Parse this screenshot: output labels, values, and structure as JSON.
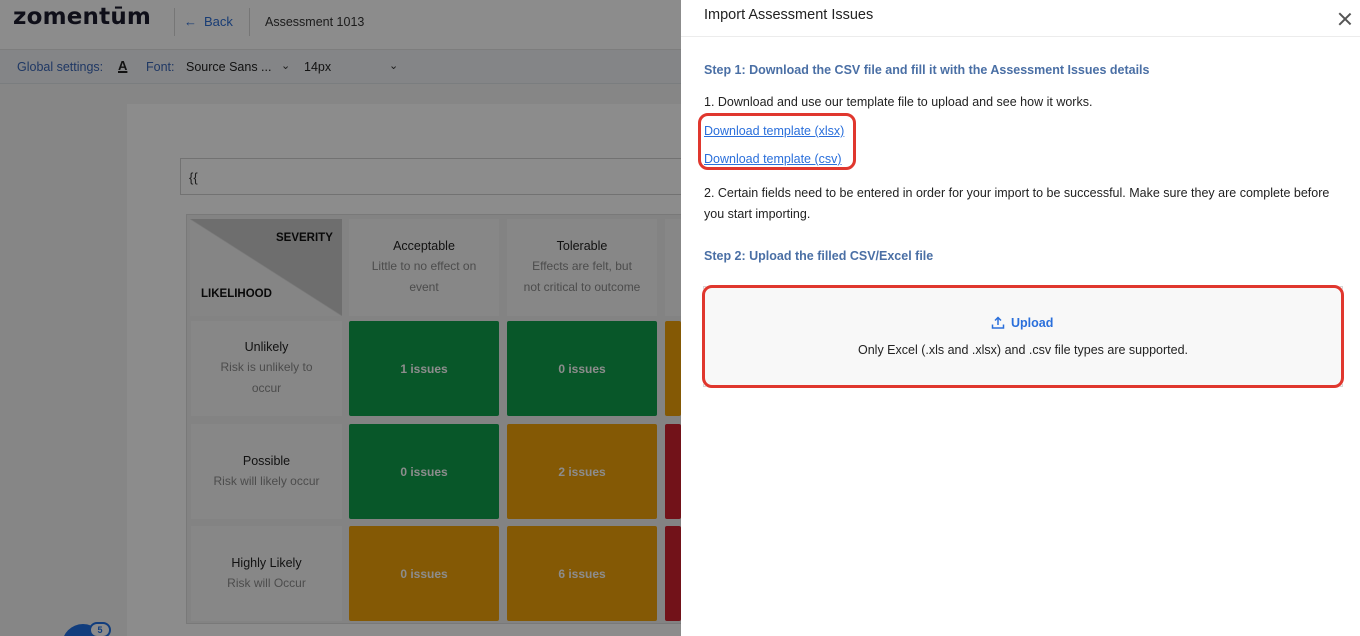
{
  "app": {
    "logo": "zomentūm",
    "back_label": "Back",
    "assessment_title": "Assessment 1013"
  },
  "settings": {
    "global_label": "Global settings:",
    "font_color_glyph": "A",
    "font_label": "Font:",
    "font_value": "Source Sans ...",
    "size_value": "14px"
  },
  "editor": {
    "input_value": "{{"
  },
  "matrix": {
    "severity_label": "SEVERITY",
    "likelihood_label": "LIKELIHOOD",
    "columns": [
      {
        "title": "Acceptable",
        "subtitle": "Little to no effect on event"
      },
      {
        "title": "Tolerable",
        "subtitle": "Effects are felt, but not critical to outcome"
      }
    ],
    "rows": [
      {
        "title": "Unlikely",
        "subtitle": "Risk is unlikely to occur",
        "cells": [
          "1 issues",
          "0 issues"
        ]
      },
      {
        "title": "Possible",
        "subtitle": "Risk will likely occur",
        "cells": [
          "0 issues",
          "2 issues"
        ]
      },
      {
        "title": "Highly Likely",
        "subtitle": "Risk will Occur",
        "cells": [
          "0 issues",
          "6 issues"
        ]
      }
    ],
    "colors": {
      "green": "#0f9e4b",
      "amber": "#f0a30a",
      "red": "#d0212f"
    }
  },
  "fab": {
    "badge": "5"
  },
  "drawer": {
    "title": "Import Assessment Issues",
    "step1_heading": "Step 1: Download the CSV file and fill it with the Assessment Issues details",
    "step1_line1": "1. Download and use our template file to upload and see how it works.",
    "download_xlsx": "Download template (xlsx)",
    "download_csv": "Download template (csv)",
    "step1_line2": "2. Certain fields need to be entered in order for your import to be successful. Make sure they are complete before you start importing.",
    "step2_heading": "Step 2: Upload the filled CSV/Excel file",
    "upload_label": "Upload",
    "upload_hint": "Only Excel (.xls and .xlsx) and .csv file types are supported.",
    "highlight_color": "#e0372e",
    "link_color": "#2a6fdb"
  }
}
